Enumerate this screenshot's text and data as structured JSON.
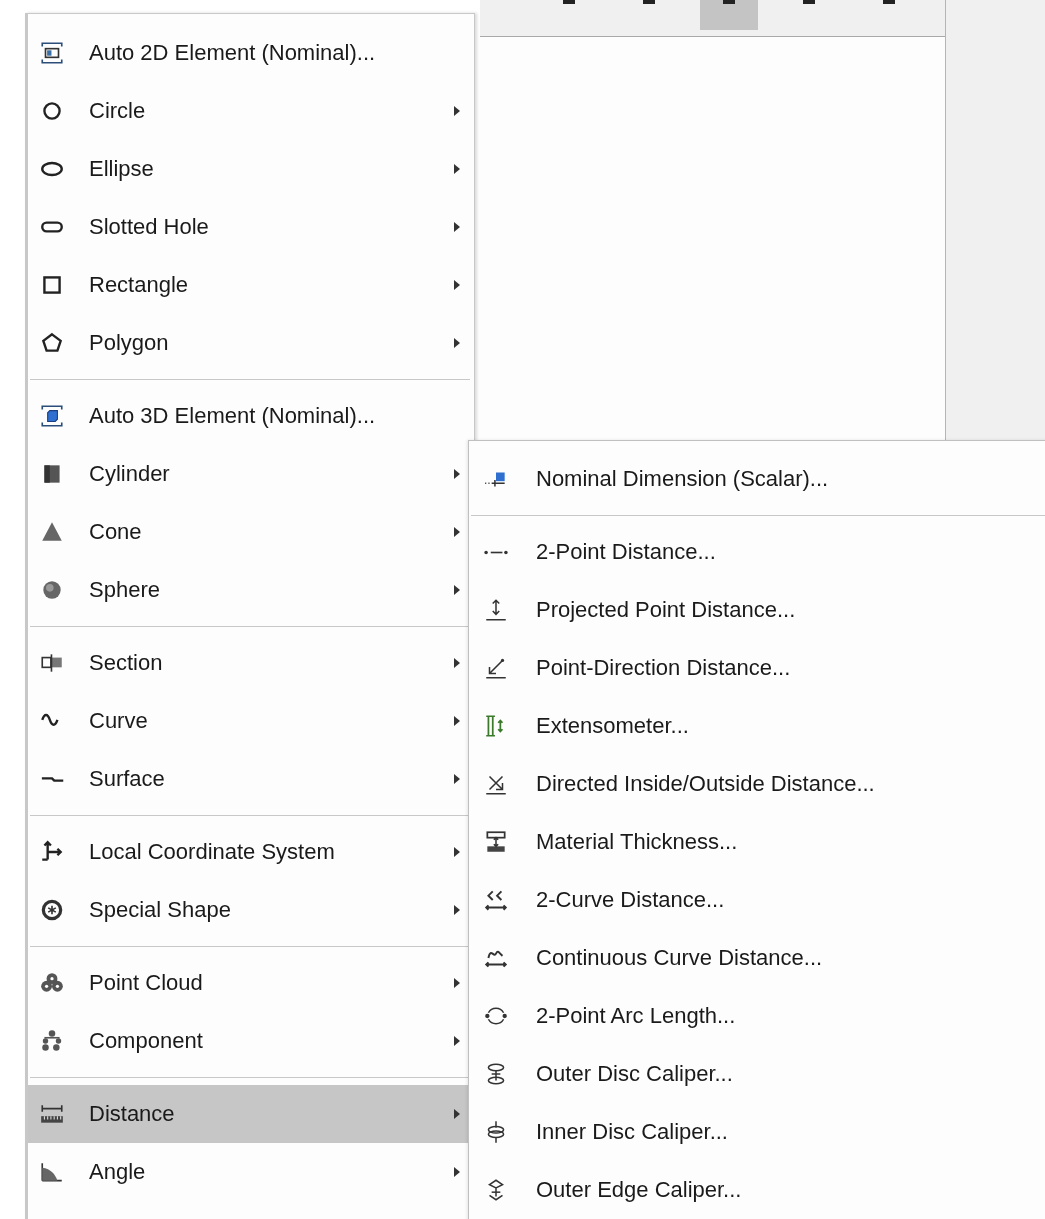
{
  "toolbar": {
    "buttons": [
      {
        "selected": false
      },
      {
        "selected": false
      },
      {
        "selected": true
      },
      {
        "selected": false
      },
      {
        "selected": false
      }
    ]
  },
  "menu": {
    "items": [
      {
        "kind": "item",
        "label": "Auto 2D Element (Nominal)...",
        "has_submenu": false,
        "selected": false
      },
      {
        "kind": "item",
        "label": "Circle",
        "has_submenu": true,
        "selected": false
      },
      {
        "kind": "item",
        "label": "Ellipse",
        "has_submenu": true,
        "selected": false
      },
      {
        "kind": "item",
        "label": "Slotted Hole",
        "has_submenu": true,
        "selected": false
      },
      {
        "kind": "item",
        "label": "Rectangle",
        "has_submenu": true,
        "selected": false
      },
      {
        "kind": "item",
        "label": "Polygon",
        "has_submenu": true,
        "selected": false
      },
      {
        "kind": "separator"
      },
      {
        "kind": "item",
        "label": "Auto 3D Element (Nominal)...",
        "has_submenu": false,
        "selected": false
      },
      {
        "kind": "item",
        "label": "Cylinder",
        "has_submenu": true,
        "selected": false
      },
      {
        "kind": "item",
        "label": "Cone",
        "has_submenu": true,
        "selected": false
      },
      {
        "kind": "item",
        "label": "Sphere",
        "has_submenu": true,
        "selected": false
      },
      {
        "kind": "separator"
      },
      {
        "kind": "item",
        "label": "Section",
        "has_submenu": true,
        "selected": false
      },
      {
        "kind": "item",
        "label": "Curve",
        "has_submenu": true,
        "selected": false
      },
      {
        "kind": "item",
        "label": "Surface",
        "has_submenu": true,
        "selected": false
      },
      {
        "kind": "separator"
      },
      {
        "kind": "item",
        "label": "Local Coordinate System",
        "has_submenu": true,
        "selected": false
      },
      {
        "kind": "item",
        "label": "Special Shape",
        "has_submenu": true,
        "selected": false
      },
      {
        "kind": "separator"
      },
      {
        "kind": "item",
        "label": "Point Cloud",
        "has_submenu": true,
        "selected": false
      },
      {
        "kind": "item",
        "label": "Component",
        "has_submenu": true,
        "selected": false
      },
      {
        "kind": "separator"
      },
      {
        "kind": "item",
        "label": "Distance",
        "has_submenu": true,
        "selected": true
      },
      {
        "kind": "item",
        "label": "Angle",
        "has_submenu": true,
        "selected": false
      }
    ]
  },
  "submenu": {
    "items": [
      {
        "kind": "item",
        "label": "Nominal Dimension (Scalar)...",
        "selected": false
      },
      {
        "kind": "separator"
      },
      {
        "kind": "item",
        "label": "2-Point Distance...",
        "selected": false
      },
      {
        "kind": "item",
        "label": "Projected Point Distance...",
        "selected": false
      },
      {
        "kind": "item",
        "label": "Point-Direction Distance...",
        "selected": false
      },
      {
        "kind": "item",
        "label": "Extensometer...",
        "selected": false
      },
      {
        "kind": "item",
        "label": "Directed Inside/Outside Distance...",
        "selected": false
      },
      {
        "kind": "item",
        "label": "Material Thickness...",
        "selected": false
      },
      {
        "kind": "item",
        "label": "2-Curve Distance...",
        "selected": false
      },
      {
        "kind": "item",
        "label": "Continuous Curve Distance...",
        "selected": false
      },
      {
        "kind": "item",
        "label": "2-Point Arc Length...",
        "selected": false
      },
      {
        "kind": "item",
        "label": "Outer Disc Caliper...",
        "selected": false
      },
      {
        "kind": "item",
        "label": "Inner Disc Caliper...",
        "selected": false
      },
      {
        "kind": "item",
        "label": "Outer Edge Caliper...",
        "selected": false
      }
    ]
  }
}
